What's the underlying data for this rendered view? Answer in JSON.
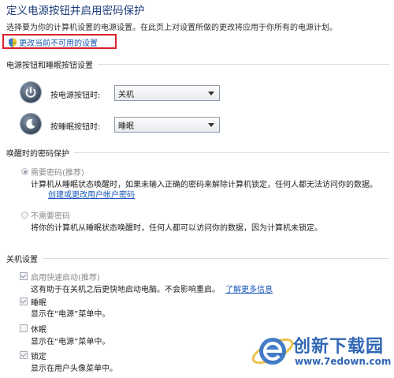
{
  "header": {
    "title": "定义电源按钮并启用密码保护",
    "subtitle": "选择要为你的计算机设置的电源设置。在此页上对设置所做的更改将应用于你所有的电源计划。",
    "change_link": "更改当前不可用的设置"
  },
  "power_section": {
    "heading": "电源按钮和睡眠按钮设置",
    "rows": [
      {
        "label": "按电源按钮时:",
        "value": "关机"
      },
      {
        "label": "按睡眠按钮时:",
        "value": "睡眠"
      }
    ]
  },
  "wake_section": {
    "heading": "唤醒时的密码保护",
    "option1": {
      "label": "需要密码(推荐)",
      "desc": "计算机从睡眠状态唤醒时，如果未输入正确的密码来解除计算机锁定，任何人都无法访问你的数据。",
      "link": "创建或更改用户帐户密码"
    },
    "option2": {
      "label": "不需要密码",
      "desc": "将你的计算机从睡眠状态唤醒时，任何人都可以访问你的数据，因为计算机未锁定。"
    }
  },
  "shutdown_section": {
    "heading": "关机设置",
    "items": [
      {
        "label": "启用快速启动(推荐)",
        "checked": true,
        "desc": "这有助于在关机之后更快地启动电脑。不会影响重启。",
        "link": "了解更多信息"
      },
      {
        "label": "睡眠",
        "checked": true,
        "desc": "显示在“电源”菜单中。"
      },
      {
        "label": "休眠",
        "checked": false,
        "desc": "显示在“电源”菜单中。"
      },
      {
        "label": "锁定",
        "checked": true,
        "desc": "显示在用户头像菜单中。"
      }
    ]
  },
  "watermark": {
    "brand": "创新下载园",
    "url": "www.7edown.com"
  },
  "colors": {
    "title": "#1e3d7a",
    "link": "#1a56b8",
    "highlight_box": "#d8212a"
  }
}
